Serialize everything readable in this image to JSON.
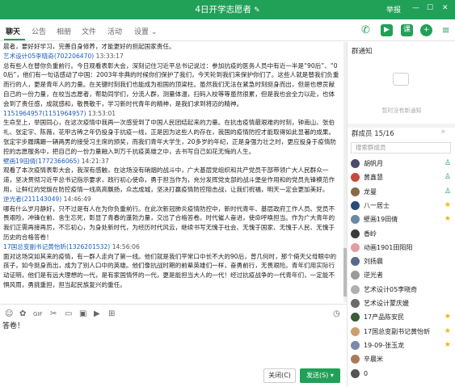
{
  "window": {
    "title": "4日开学志愿者",
    "title_edit_icon": "edit-icon",
    "report_label": "举报",
    "colors": {
      "header": "#21a058",
      "name_link": "#1c5db8"
    }
  },
  "tabs": [
    {
      "label": "聊天"
    },
    {
      "label": "公告"
    },
    {
      "label": "相册"
    },
    {
      "label": "文件"
    },
    {
      "label": "活动"
    },
    {
      "label": "设置"
    }
  ],
  "toolbar_icons": [
    "voice-call-icon",
    "video-call-icon",
    "classroom-icon",
    "add-icon",
    "more-icon"
  ],
  "messages": [
    {
      "text": "晨者，要好好学习，完善自身修养，才能更好的担起国家责任。"
    },
    {
      "name": "艺术设计05李晓奇",
      "id": "(702206470)",
      "time": "13:33:17",
      "text": "总有些人在替你负重前行。今日观看表彰大会，深刻记住习近平总书记说过：参加抗疫的医务人员中有近一半是“90后”、“00后”，他们有一句话感动了中国：2003年非典的时候你们保护了我们，今天轮到我们来保护你们了。这些人就是替我们负重而行的人，更是青年人的力量。在关键时刻我们也能成为祖国的顶梁柱。虽然我们无法在紧急时刻挺身而出，但是也想贡献自己的一份力量，在校当志愿者，帮助同学们，分流人群，测量体温，扫码入校等等虽然很累，但是我也会全力以赴，也体会到了责任感，成就感和，敬畏敬干，学习新时代青年的精神，是我们求到将迈的精神。"
    },
    {
      "name": "1151964957",
      "id": "(1151964957)",
      "time": "13:53:01",
      "text": "生命至上，举国同心，在这次疫情中我再一次感受到了中国人民团结起来的力量。在抗击疫情最艰难的时刻，钟南山、张伯礼、张定宇、陈薇，花甲古稀之年仍投身于抗疫一线，正是因为这些人的存在，我国的疫情防控才能取得如此显著的成果。张定宇步履蹒跚一辆两男的接受习主席的颁奖，而我们青年大学生，20多岁的年纪，正是身强力壮之时，更应投身于疫情防控的志愿服务中，把自己的一份力量融入到万千抗疫英雄之中，去书写自己如花无悔的人生。"
    },
    {
      "name": "壁画19田倩",
      "id": "(1772366065)",
      "time": "14:21:37",
      "text": "观看了本次疫情表彰大会，我深有感触，在这场没有硝烟的战斗中，广大基层党组织和共产党员干部带领广大人民群众一道，坚决贯彻习近平总书记指示要求，践行初心使命，勇于担当作为，充分发挥党支部的战斗堡垒作用和的党员先锋模范作用，让鲜红的党旗在防控疫情一线高高飘扬，众志成城，坚决打赢疫情防控阻击战，让我们祝福，明天一定会更加美好。"
    },
    {
      "name": "逆光者",
      "id": "(211143049)",
      "time": "14:46:49",
      "text": "哪有什么岁月静好，只不过是有人在为你负重前行。在此次新冠肺炎疫情防控中，新时代青年、基层政府工作人员、党员不畏艰险，冲锋在前、舍生忘死，彰显了青春的蓬勃力量，交出了合格答卷。时代催人奋进，使命呼唤担当。作为广大青年的我们正需再接再厉，不忘初心，为身处新时代，为经历时代风云，继续书写无愧于社会、无愧于国家、无愧于人民、无愧于历史的合格答卷！"
    },
    {
      "name": "17国总变副书记黄怡昕",
      "id": "(1326201532)",
      "time": "14:56:06",
      "text": "面对这场突如其来的疫情，有一群人走向了第一线。他们就是我们平常口中长不大的90后，曾几何时，那个倚天父母眼中的孩子，如今挺身而出，成为了别人口中的英雄。他们像抗战时期的前辈英雄们一样，奋勇前行，无畏艰险。青年们用实际行动证明，他们是有远大理想的一代，是有家国情怀的一代，更是能担当大人的一代！经过抗疫战争的一代青年们，一定能不惧风雨，勇挑重担，担当起民族复兴的重任。"
    }
  ],
  "input": {
    "tool_icons": [
      "emoji-icon",
      "sticker-icon",
      "gif-icon",
      "cut-icon",
      "folder-icon",
      "image-icon",
      "video-icon",
      "screenshot-icon"
    ],
    "text": "答卷！",
    "close_label": "关闭(C)",
    "send_label": "发送(S)"
  },
  "sidebar": {
    "notice_title": "群通知",
    "notice_empty": "暂时没有新通知",
    "members_title": "群成员 15/16",
    "search_placeholder": "搜索群成员",
    "members": [
      {
        "name": "胡帆月",
        "color": "#4a4a6a",
        "badge": "person-icon"
      },
      {
        "name": "黄鑫慧",
        "color": "#c84a3a",
        "badge": "person-icon"
      },
      {
        "name": "龙曼",
        "color": "#8a6a4a",
        "badge": "person-icon"
      },
      {
        "name": "八一居士",
        "color": "#2a4a7a",
        "badge": "star-icon"
      },
      {
        "name": "壁画19田倩",
        "color": "#6a8aa0",
        "badge": "star-icon"
      },
      {
        "name": "香岭",
        "color": "#3a3a3a",
        "badge": ""
      },
      {
        "name": "动画1901田阳阳",
        "color": "#e0a0a0",
        "badge": ""
      },
      {
        "name": "刘扬晨",
        "color": "#5a6a8a",
        "badge": ""
      },
      {
        "name": "逆光者",
        "color": "#9a9a9a",
        "badge": ""
      },
      {
        "name": "艺术设计05李晓奇",
        "color": "#b0b0b0",
        "badge": ""
      },
      {
        "name": "艺术设计蒙庆媛",
        "color": "#6a6a6a",
        "badge": ""
      },
      {
        "name": "17产品陈安民",
        "color": "#3a5a3a",
        "badge": "star-icon"
      },
      {
        "name": "17国总变副书记黄怡昕",
        "color": "#c9a070",
        "badge": "star-icon"
      },
      {
        "name": "19-09-张玉龙",
        "color": "#7a8aaa",
        "badge": "star-icon"
      },
      {
        "name": "辛晨米",
        "color": "#aa7a5a",
        "badge": ""
      },
      {
        "name": "0",
        "color": "#555555",
        "badge": ""
      }
    ]
  }
}
